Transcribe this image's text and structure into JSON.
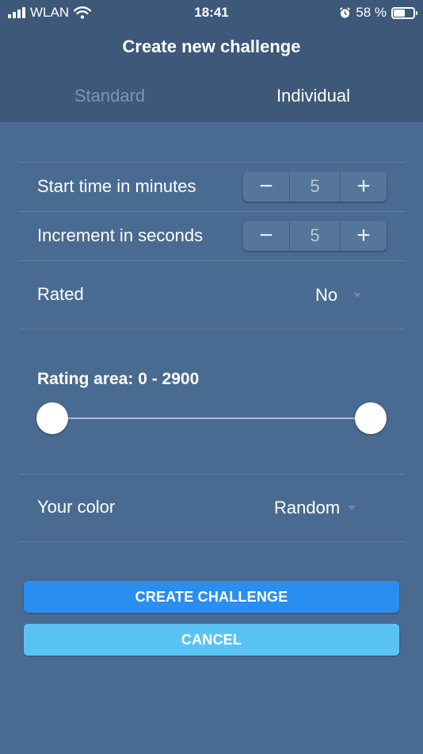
{
  "status_bar": {
    "carrier": "WLAN",
    "time": "18:41",
    "battery_percent": "58 %",
    "battery_level": 0.58
  },
  "header": {
    "title": "Create new challenge",
    "tabs": [
      {
        "label": "Standard",
        "active": false
      },
      {
        "label": "Individual",
        "active": true
      }
    ]
  },
  "form": {
    "start_time": {
      "label": "Start time in minutes",
      "value": "5",
      "minus": "−",
      "plus": "+"
    },
    "increment": {
      "label": "Increment in seconds",
      "value": "5",
      "minus": "−",
      "plus": "+"
    },
    "rated": {
      "label": "Rated",
      "value": "No"
    },
    "rating_area": {
      "label": "Rating area: 0 - 2900",
      "min": 0,
      "max": 2900,
      "low": 0,
      "high": 2900
    },
    "color": {
      "label": "Your color",
      "value": "Random"
    }
  },
  "actions": {
    "create_label": "CREATE CHALLENGE",
    "cancel_label": "CANCEL"
  },
  "colors": {
    "background": "#4a6b91",
    "header": "#3d5878",
    "primary_button": "#2a8ef0",
    "secondary_button": "#5ac3f5"
  },
  "icons": [
    "signal-icon",
    "wifi-icon",
    "alarm-icon",
    "battery-icon",
    "caret-down-icon"
  ]
}
